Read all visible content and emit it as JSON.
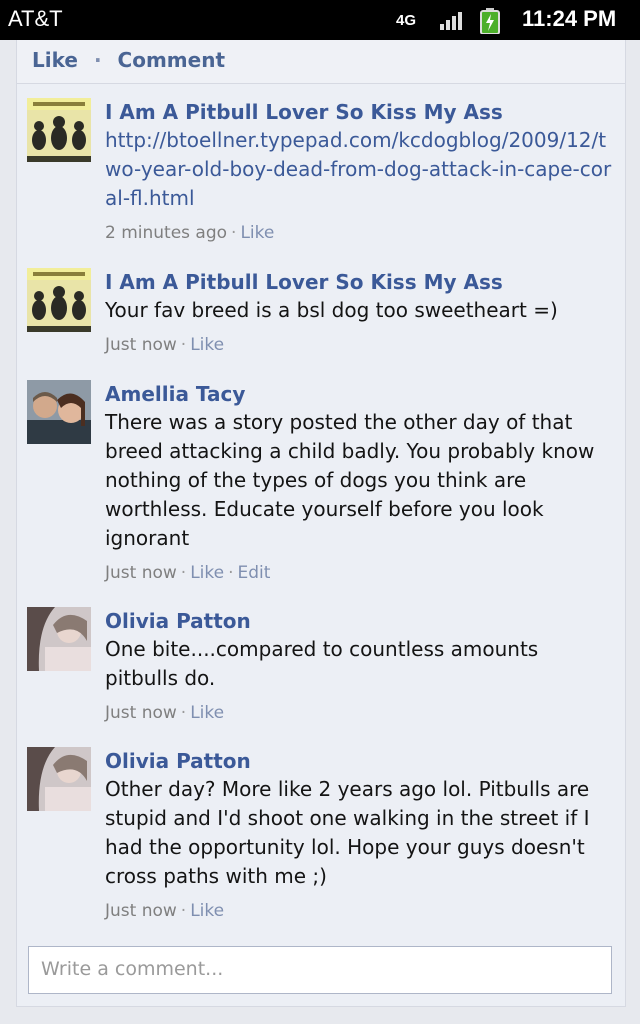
{
  "status_bar": {
    "carrier": "AT&T",
    "network": "4G",
    "time": "11:24 PM",
    "icons": [
      "signal-bars-icon",
      "battery-charging-icon"
    ]
  },
  "actions": {
    "like_label": "Like",
    "separator": "·",
    "comment_label": "Comment"
  },
  "comments": [
    {
      "author": "I Am A Pitbull Lover So Kiss My Ass",
      "text": "http://btoellner.typepad.com/kcdogblog/2009/12/two-year-old-boy-dead-from-dog-attack-in-cape-coral-fl.html",
      "time": "2 minutes ago",
      "actions": [
        "Like"
      ]
    },
    {
      "author": "I Am A Pitbull Lover So Kiss My Ass",
      "text": "Your fav breed is a bsl dog too sweetheart =)",
      "time": "Just now",
      "actions": [
        "Like"
      ]
    },
    {
      "author": "Amellia Tacy",
      "text": "There was a story posted the other day of that breed attacking a child badly. You probably know nothing of the types of dogs you think are worthless. Educate yourself before you look ignorant",
      "time": "Just now",
      "actions": [
        "Like",
        "Edit"
      ]
    },
    {
      "author": "Olivia Patton",
      "text": "One bite....compared to countless amounts pitbulls do.",
      "time": "Just now",
      "actions": [
        "Like"
      ]
    },
    {
      "author": "Olivia Patton",
      "text": "Other day? More like 2 years ago lol. Pitbulls are stupid and I'd shoot one walking in the street if I had the opportunity lol. Hope your guys doesn't cross paths with me ;)",
      "time": "Just now",
      "actions": [
        "Like"
      ]
    }
  ],
  "comment_input": {
    "placeholder": "Write a comment..."
  },
  "colors": {
    "link": "#3b5998",
    "muted": "#7f7f7f",
    "background": "#eceff5"
  }
}
